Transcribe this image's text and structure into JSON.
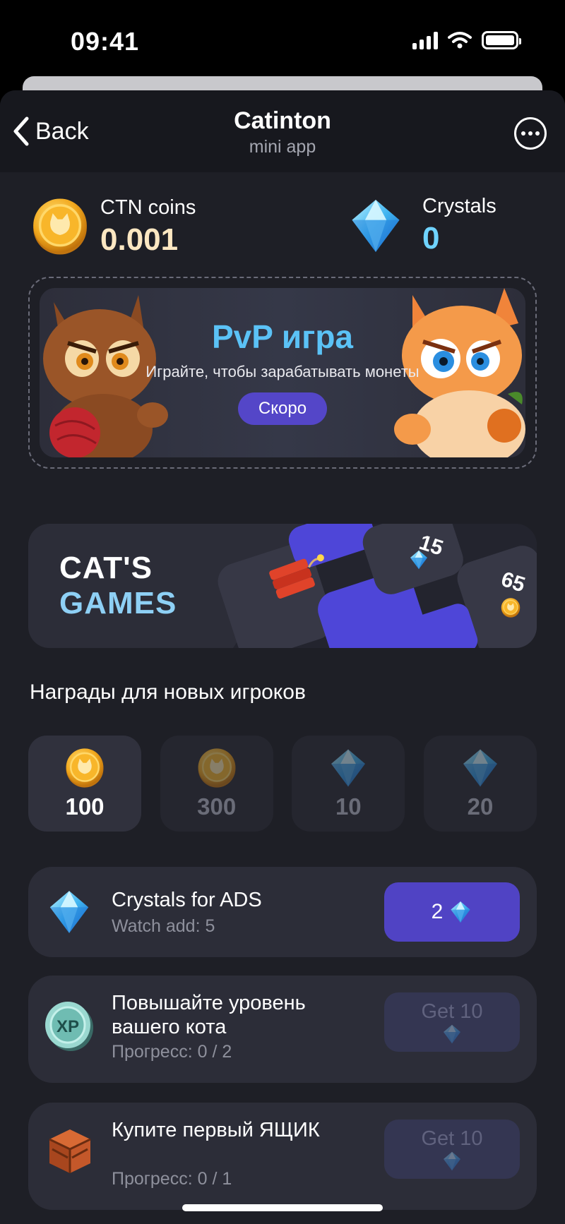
{
  "status_bar": {
    "time": "09:41"
  },
  "nav": {
    "back_label": "Back",
    "title": "Catinton",
    "subtitle": "mini app"
  },
  "balances": {
    "coins": {
      "label": "CTN coins",
      "value": "0.001",
      "icon": "coin-icon"
    },
    "crystals": {
      "label": "Crystals",
      "value": "0",
      "icon": "crystal-icon"
    }
  },
  "pvp": {
    "title": "PvP игра",
    "description": "Играйте, чтобы зарабатывать монеты",
    "button": "Скоро"
  },
  "games": {
    "line1": "CAT'S",
    "line2": "GAMES",
    "badges": [
      "15",
      "65"
    ]
  },
  "rewards": {
    "title": "Награды для новых игроков",
    "items": [
      {
        "value": "100",
        "icon": "coin-icon",
        "active": true
      },
      {
        "value": "300",
        "icon": "coin-icon",
        "active": false
      },
      {
        "value": "10",
        "icon": "crystal-icon",
        "active": false
      },
      {
        "value": "20",
        "icon": "crystal-icon",
        "active": false
      }
    ]
  },
  "tasks": [
    {
      "name": "Crystals for ADS",
      "progress": "Watch add: 5",
      "button": "2",
      "icon": "crystal-icon"
    },
    {
      "name": "Повышайте уровень вашего кота",
      "progress": "Прогресс: 0 / 2",
      "button": "Get 10",
      "icon": "xp-coin-icon"
    },
    {
      "name": "Купите первый ЯЩИК",
      "progress": "Прогресс: 0 / 1",
      "button": "Get 10",
      "icon": "crate-icon"
    }
  ],
  "colors": {
    "accent": "#5043c4",
    "coin_value": "#fbe7c2",
    "crystal_value": "#6fd3ff",
    "pvp_title": "#5bc2f6"
  }
}
